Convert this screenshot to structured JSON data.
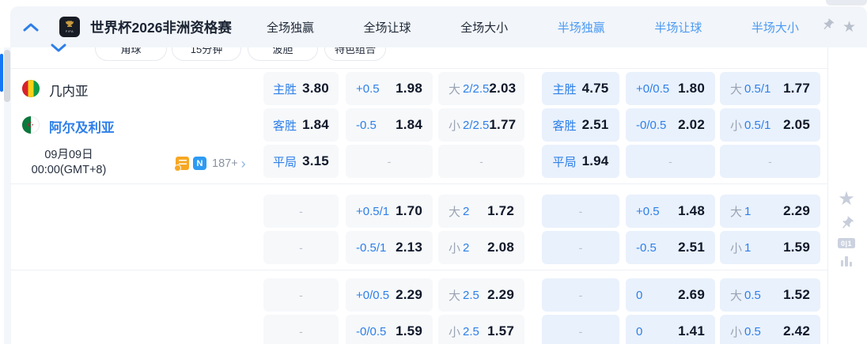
{
  "header": {
    "league_title": "世界杯2026非洲资格赛",
    "tabs": [
      {
        "label": "全场独赢",
        "active": false
      },
      {
        "label": "全场让球",
        "active": false
      },
      {
        "label": "全场大小",
        "active": false
      },
      {
        "label": "半场独赢",
        "active": true
      },
      {
        "label": "半场让球",
        "active": true
      },
      {
        "label": "半场大小",
        "active": true
      }
    ]
  },
  "filters": {
    "pills": [
      "角球",
      "15分钟",
      "波胆",
      "特色组合"
    ]
  },
  "match": {
    "home_team": "几内亚",
    "away_team": "阿尔及利亚",
    "date": "09月09日",
    "time": "00:00(GMT+8)",
    "extra_markets": "187+",
    "news_badge": "N"
  },
  "odds": {
    "empty_symbol": "-",
    "rows": [
      [
        {
          "label": "主胜",
          "value": "3.80"
        },
        {
          "label": "+0.5",
          "value": "1.98"
        },
        {
          "group": "大",
          "label": "2/2.5",
          "value": "2.03"
        },
        {
          "label": "主胜",
          "value": "4.75"
        },
        {
          "label": "+0/0.5",
          "value": "1.80"
        },
        {
          "group": "大",
          "label": "0.5/1",
          "value": "1.77"
        }
      ],
      [
        {
          "label": "客胜",
          "value": "1.84"
        },
        {
          "label": "-0.5",
          "value": "1.84"
        },
        {
          "group": "小",
          "label": "2/2.5",
          "value": "1.77"
        },
        {
          "label": "客胜",
          "value": "2.51"
        },
        {
          "label": "-0/0.5",
          "value": "2.02"
        },
        {
          "group": "小",
          "label": "0.5/1",
          "value": "2.05"
        }
      ],
      [
        {
          "label": "平局",
          "value": "3.15"
        },
        {
          "empty": true
        },
        {
          "empty": true
        },
        {
          "label": "平局",
          "value": "1.94"
        },
        {
          "empty": true
        },
        {
          "empty": true
        }
      ],
      [
        {
          "empty": true
        },
        {
          "label": "+0.5/1",
          "value": "1.70"
        },
        {
          "group": "大",
          "label": "2",
          "value": "1.72"
        },
        {
          "empty": true
        },
        {
          "label": "+0.5",
          "value": "1.48"
        },
        {
          "group": "大",
          "label": "1",
          "value": "2.29"
        }
      ],
      [
        {
          "empty": true
        },
        {
          "label": "-0.5/1",
          "value": "2.13"
        },
        {
          "group": "小",
          "label": "2",
          "value": "2.08"
        },
        {
          "empty": true
        },
        {
          "label": "-0.5",
          "value": "2.51"
        },
        {
          "group": "小",
          "label": "1",
          "value": "1.59"
        }
      ],
      [
        {
          "empty": true
        },
        {
          "label": "+0/0.5",
          "value": "2.29"
        },
        {
          "group": "大",
          "label": "2.5",
          "value": "2.29"
        },
        {
          "empty": true
        },
        {
          "label": "0",
          "value": "2.69"
        },
        {
          "group": "大",
          "label": "0.5",
          "value": "1.52"
        }
      ],
      [
        {
          "empty": true
        },
        {
          "label": "-0/0.5",
          "value": "1.59"
        },
        {
          "group": "小",
          "label": "2.5",
          "value": "1.57"
        },
        {
          "empty": true
        },
        {
          "label": "0",
          "value": "1.41"
        },
        {
          "group": "小",
          "label": "0.5",
          "value": "2.42"
        }
      ]
    ]
  },
  "side_tools": {
    "score_badge": "0|1"
  },
  "icons": {
    "star": "★",
    "chevron_right": "›",
    "crescent": "☪"
  },
  "colors": {
    "accent_blue": "#2e7fe8",
    "halftime_tab_blue": "#4a9af3",
    "fulltime_cell_bg": "#f6f8fa",
    "halftime_cell_bg": "#e9f1fc",
    "orange_icon": "#f7a823",
    "news_blue": "#2d9bf3"
  }
}
